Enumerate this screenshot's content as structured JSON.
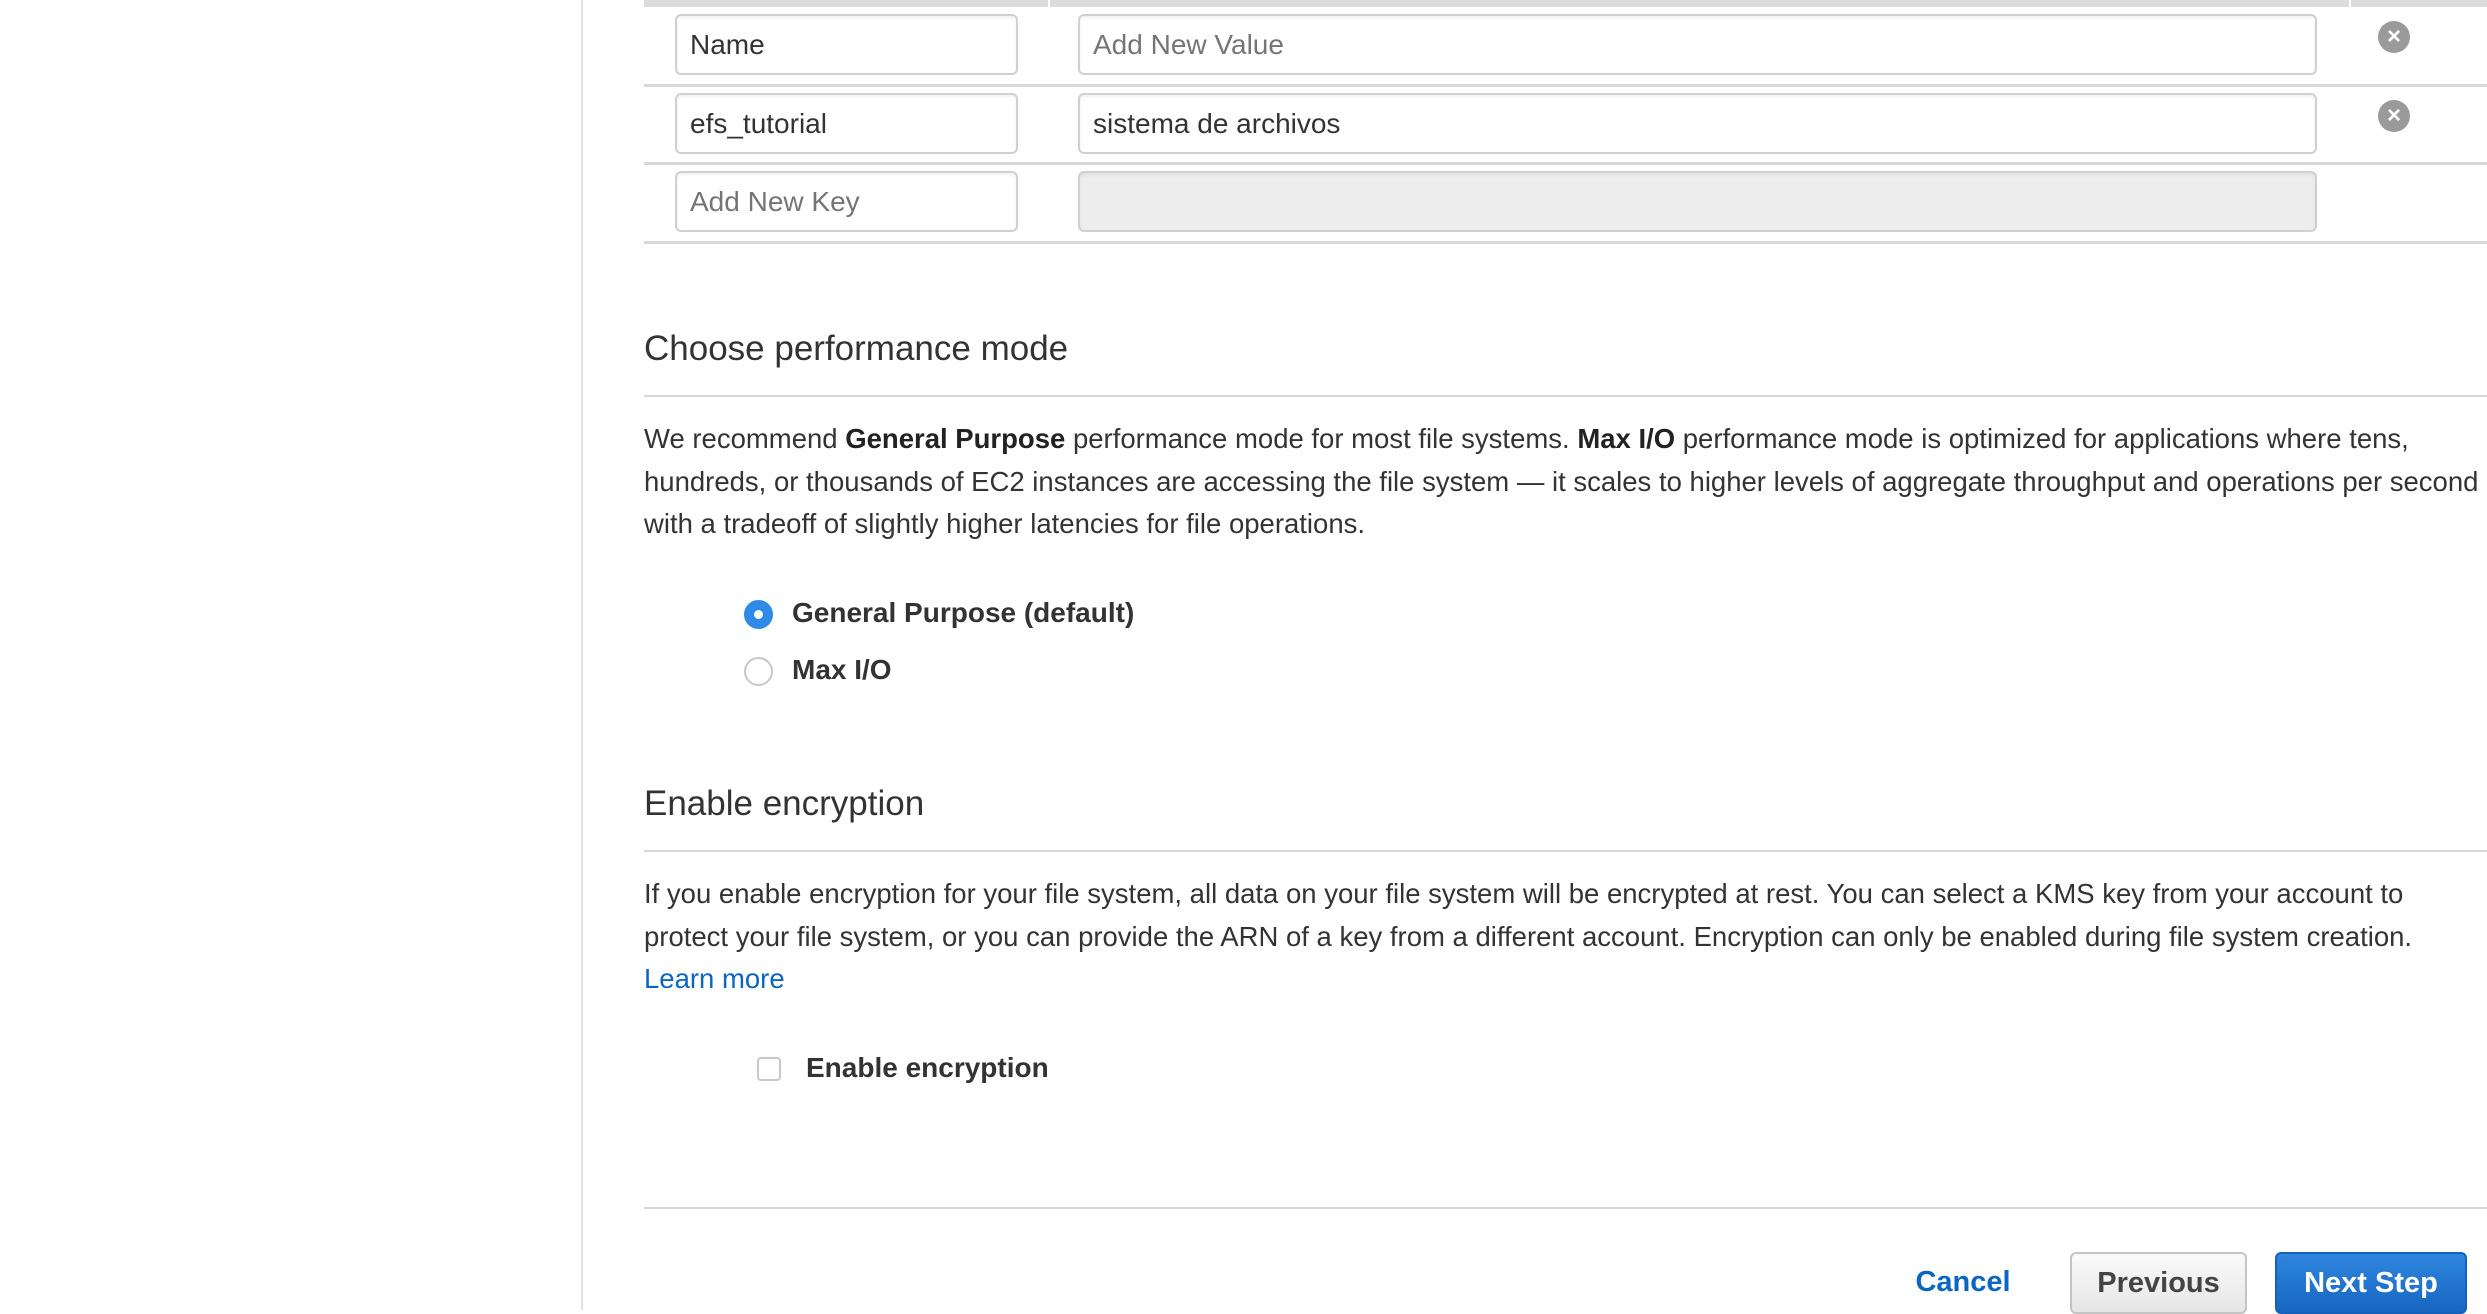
{
  "tags": {
    "rows": [
      {
        "key": "Name",
        "value": "",
        "value_placeholder": "Add New Value"
      },
      {
        "key": "efs_tutorial",
        "value": "sistema de archivos"
      }
    ],
    "new_key_placeholder": "Add New Key",
    "remove_icon": "circle-x-icon"
  },
  "performance": {
    "heading": "Choose performance mode",
    "desc_1": "We recommend ",
    "desc_b1": "General Purpose",
    "desc_2": " performance mode for most file systems. ",
    "desc_b2": "Max I/O",
    "desc_3": " performance mode is optimized for applications where tens, hundreds, or thousands of EC2 instances are accessing the file system — it scales to higher levels of aggregate throughput and operations per second with a tradeoff of slightly higher latencies for file operations.",
    "options": [
      {
        "label": "General Purpose (default)",
        "selected": true
      },
      {
        "label": "Max I/O",
        "selected": false
      }
    ]
  },
  "encryption": {
    "heading": "Enable encryption",
    "desc": "If you enable encryption for your file system, all data on your file system will be encrypted at rest. You can select a KMS key from your account to protect your file system, or you can provide the ARN of a key from a different account. Encryption can only be enabled during file system creation.",
    "learn_more": "Learn more",
    "checkbox_label": "Enable encryption",
    "checked": false
  },
  "footer": {
    "cancel": "Cancel",
    "previous": "Previous",
    "next": "Next Step"
  },
  "colors": {
    "accent": "#2f8ae8",
    "link": "#0b66c2",
    "primary_button": "#1a6fcf"
  }
}
